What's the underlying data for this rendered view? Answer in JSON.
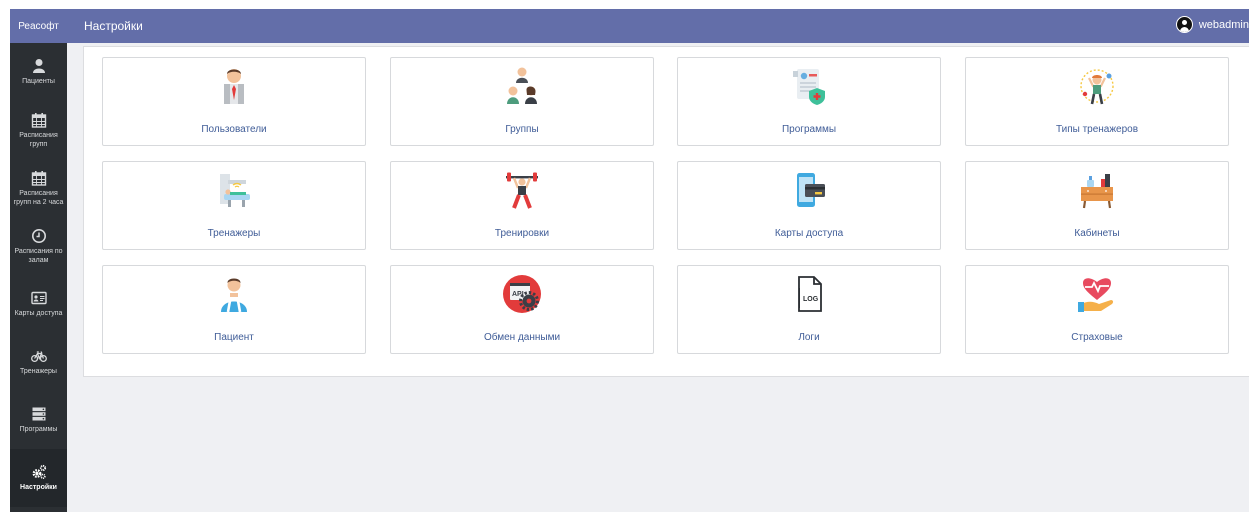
{
  "sidebar": {
    "brand": "Реасофт",
    "items": [
      {
        "label": "Пациенты",
        "icon": "user-icon"
      },
      {
        "label": "Расписания групп",
        "icon": "calendar-icon"
      },
      {
        "label": "Расписания групп на 2 часа",
        "icon": "calendar-icon"
      },
      {
        "label": "Расписания по залам",
        "icon": "clock-icon"
      },
      {
        "label": "Карты доступа",
        "icon": "id-card-icon"
      },
      {
        "label": "Тренажеры",
        "icon": "bicycle-icon"
      },
      {
        "label": "Программы",
        "icon": "server-icon"
      },
      {
        "label": "Настройки",
        "icon": "cogs-icon",
        "active": true
      }
    ]
  },
  "header": {
    "title": "Настройки",
    "user": "webadmin"
  },
  "tiles": [
    {
      "label": "Пользователи",
      "icon": "businessman-icon"
    },
    {
      "label": "Группы",
      "icon": "group-people-icon"
    },
    {
      "label": "Программы",
      "icon": "document-shield-icon"
    },
    {
      "label": "Типы тренажеров",
      "icon": "trainer-person-icon"
    },
    {
      "label": "Тренажеры",
      "icon": "medical-scanner-icon"
    },
    {
      "label": "Тренировки",
      "icon": "weightlifter-icon"
    },
    {
      "label": "Карты доступа",
      "icon": "phone-card-icon"
    },
    {
      "label": "Кабинеты",
      "icon": "office-furniture-icon"
    },
    {
      "label": "Пациент",
      "icon": "patient-icon"
    },
    {
      "label": "Обмен данными",
      "icon": "api-gear-icon"
    },
    {
      "label": "Логи",
      "icon": "log-file-icon",
      "icon_text": "LOG"
    },
    {
      "label": "Страховые",
      "icon": "heart-hand-icon"
    }
  ],
  "colors": {
    "accent": "#636ea9",
    "sidebar": "#2b2f33",
    "tile_label": "#3f5c97",
    "background": "#eff0f3"
  }
}
